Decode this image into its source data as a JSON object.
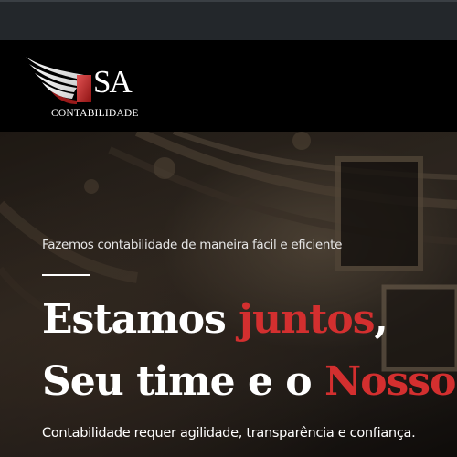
{
  "brand": {
    "mark": "SA",
    "subtitle": "CONTABILIDADE",
    "accent_color": "#d32f2f"
  },
  "hero": {
    "tagline": "Fazemos contabilidade de maneira fácil e eficiente",
    "headline_line1_a": "Estamos ",
    "headline_line1_b": "juntos",
    "headline_line1_c": ",",
    "headline_line2_a": "Seu time e o ",
    "headline_line2_b": "Nosso",
    "headline_line2_c": ".",
    "subline": "Contabilidade requer agilidade, transparência e confiança."
  }
}
